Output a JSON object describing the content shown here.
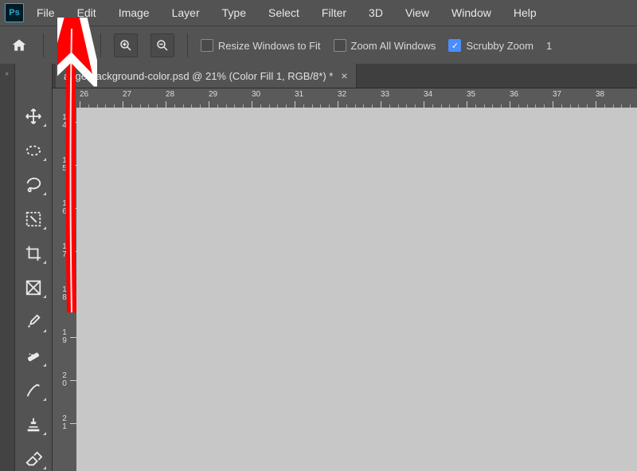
{
  "app": {
    "logo_text": "Ps",
    "menu": [
      "File",
      "Edit",
      "Image",
      "Layer",
      "Type",
      "Select",
      "Filter",
      "3D",
      "View",
      "Window",
      "Help"
    ]
  },
  "options": {
    "resize_windows_label": "Resize Windows to Fit",
    "zoom_all_label": "Zoom All Windows",
    "scrubby_zoom_label": "Scrubby Zoom",
    "zoom_value": "1"
  },
  "document": {
    "tab_title": "ange-background-color.psd @ 21% (Color Fill 1, RGB/8*) *"
  },
  "rulers": {
    "h_labels": [
      "26",
      "27",
      "28",
      "29",
      "30",
      "31",
      "32",
      "33",
      "34",
      "35",
      "36",
      "37",
      "38"
    ],
    "v_labels": [
      "14",
      "15",
      "16",
      "17",
      "18",
      "19",
      "20",
      "21"
    ]
  },
  "tools": [
    "move-tool",
    "marquee-tool",
    "lasso-tool",
    "brush-tool",
    "crop-tool",
    "frame-tool",
    "eyedropper-tool",
    "healing-brush-tool",
    "pencil-tool",
    "clone-stamp-tool",
    "eraser-tool"
  ]
}
